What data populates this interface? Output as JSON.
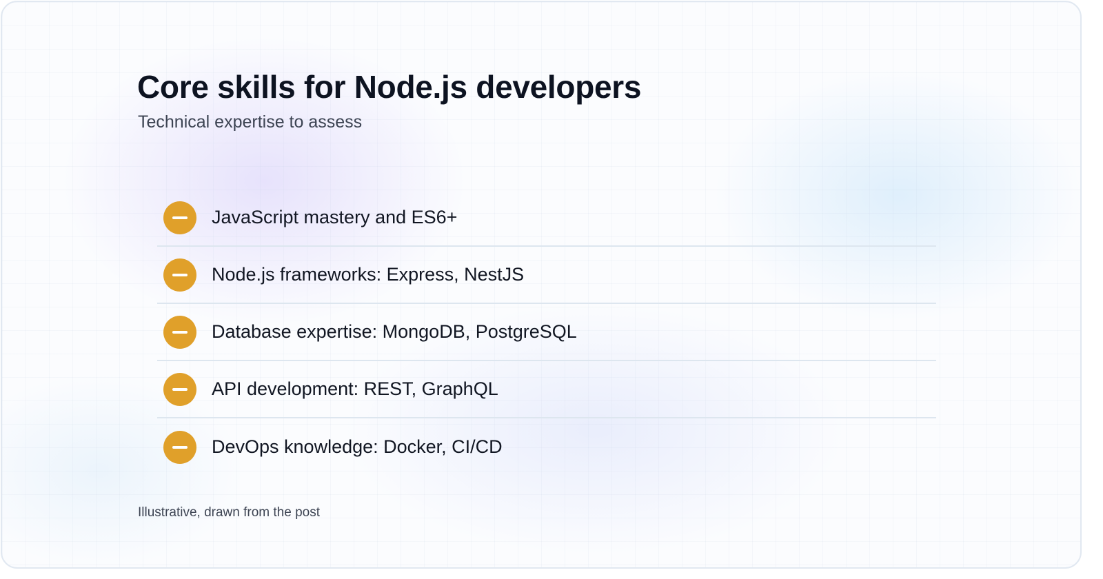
{
  "header": {
    "title": "Core skills for Node.js developers",
    "subtitle": "Technical expertise to assess"
  },
  "skills": [
    {
      "label": "JavaScript mastery and ES6+",
      "icon": "minus-icon"
    },
    {
      "label": "Node.js frameworks: Express, NestJS",
      "icon": "minus-icon"
    },
    {
      "label": "Database expertise: MongoDB, PostgreSQL",
      "icon": "minus-icon"
    },
    {
      "label": "API development: REST, GraphQL",
      "icon": "minus-icon"
    },
    {
      "label": "DevOps knowledge: Docker, CI/CD",
      "icon": "minus-icon"
    }
  ],
  "footer": {
    "note": "Illustrative, drawn from the post"
  },
  "colors": {
    "accent": "#e0a02a",
    "title": "#0d1321",
    "divider": "#dde6ef"
  }
}
